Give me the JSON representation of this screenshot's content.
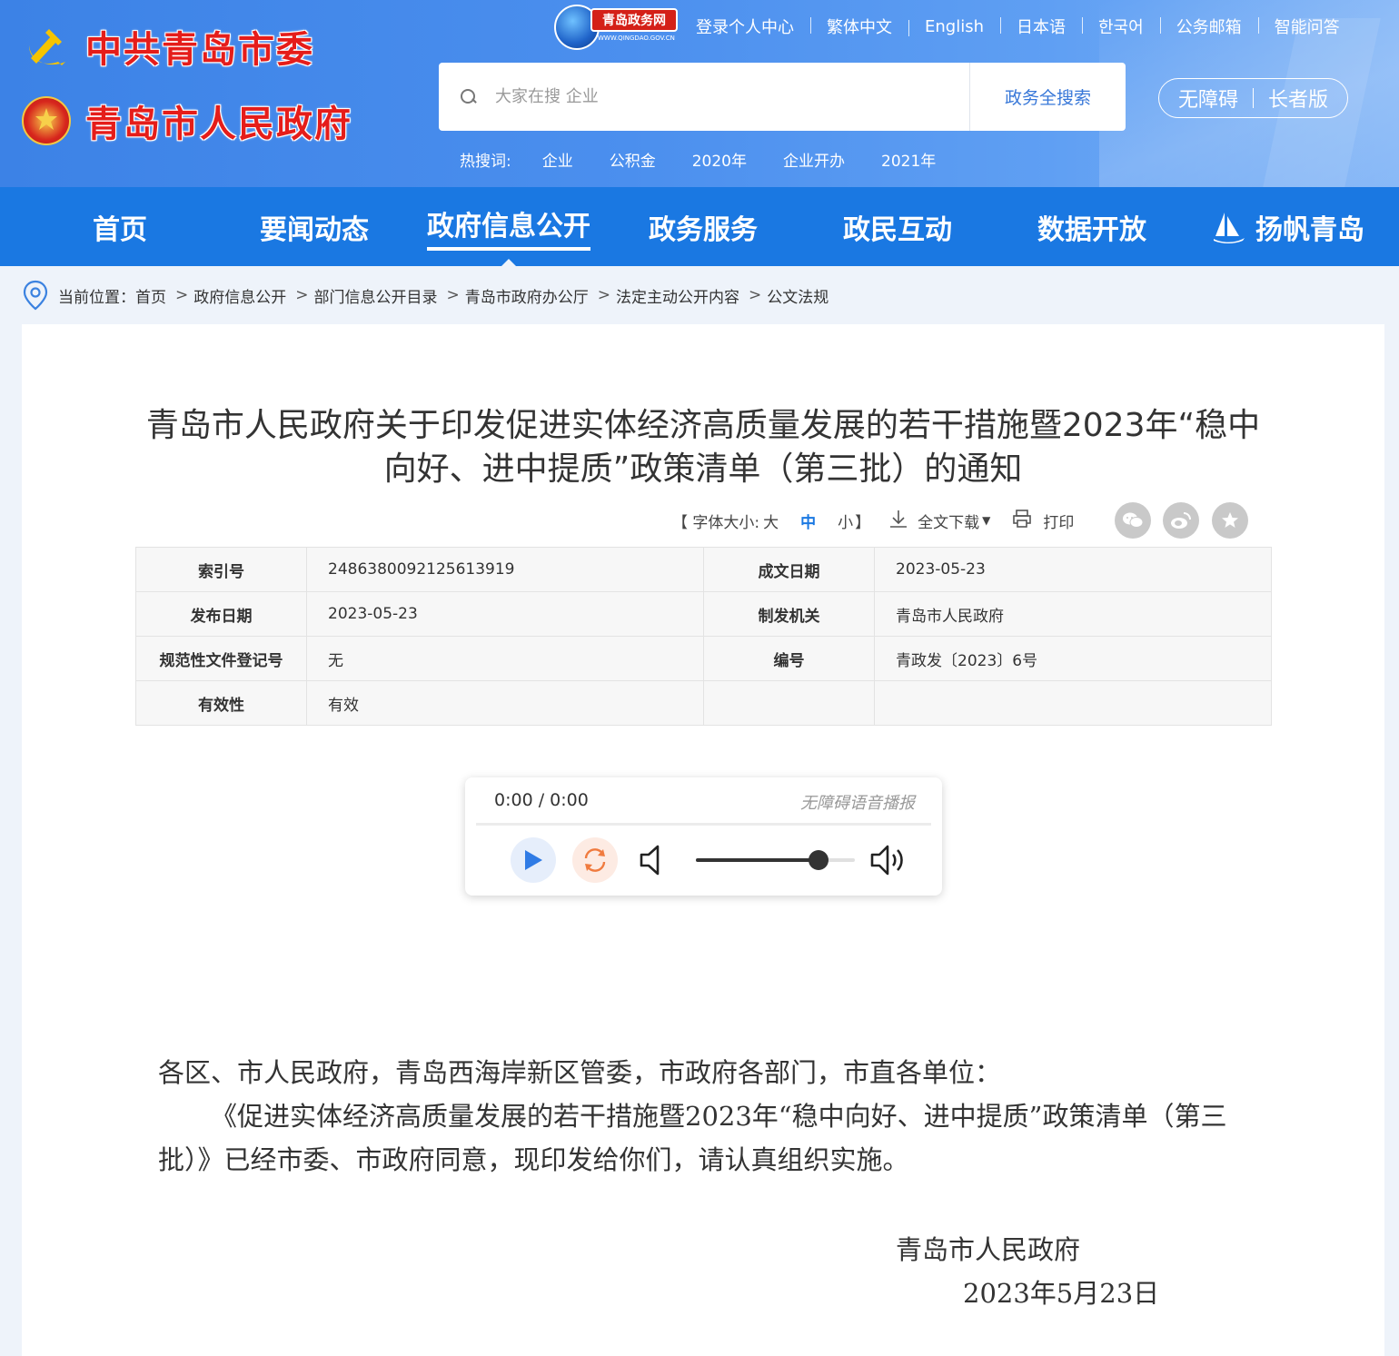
{
  "header": {
    "party_name": "中共青岛市委",
    "gov_name": "青岛市人民政府",
    "portal_badge": {
      "name": "青岛政务网",
      "url": "WWW.QINGDAO.GOV.CN"
    },
    "top_links": [
      "登录个人中心",
      "繁体中文",
      "English",
      "日本语",
      "한국어",
      "公务邮箱",
      "智能问答"
    ],
    "search": {
      "placeholder": "大家在搜 企业",
      "button": "政务全搜索"
    },
    "hot_words": {
      "label": "热搜词:",
      "items": [
        "企业",
        "公积金",
        "2020年",
        "企业开办",
        "2021年"
      ]
    },
    "accessibility": {
      "barrier_free": "无障碍",
      "elder_mode": "长者版"
    }
  },
  "nav": {
    "items": [
      "首页",
      "要闻动态",
      "政府信息公开",
      "政务服务",
      "政民互动",
      "数据开放",
      "扬帆青岛"
    ],
    "active": "政府信息公开"
  },
  "breadcrumb": {
    "label": "当前位置：",
    "items": [
      "首页",
      "政府信息公开",
      "部门信息公开目录",
      "青岛市政府办公厅",
      "法定主动公开内容",
      "公文法规"
    ]
  },
  "document": {
    "title": "青岛市人民政府关于印发促进实体经济高质量发展的若干措施暨2023年“稳中向好、进中提质”政策清单（第三批）的通知",
    "tools": {
      "font_size_label": "【 字体大小:",
      "font_sizes": [
        "大",
        "中",
        "小"
      ],
      "font_size_close": "】",
      "download": "全文下载",
      "print": "打印"
    },
    "meta": {
      "index_no_label": "索引号",
      "index_no": "2486380092125613919",
      "written_date_label": "成文日期",
      "written_date": "2023-05-23",
      "publish_date_label": "发布日期",
      "publish_date": "2023-05-23",
      "issuer_label": "制发机关",
      "issuer": "青岛市人民政府",
      "reg_no_label": "规范性文件登记号",
      "reg_no": "无",
      "doc_no_label": "编号",
      "doc_no": "青政发〔2023〕6号",
      "validity_label": "有效性",
      "validity": "有效"
    },
    "player": {
      "time": "0:00 / 0:00",
      "title": "无障碍语音播报",
      "volume": 0.77
    },
    "body": {
      "salutation": "各区、市人民政府，青岛西海岸新区管委，市政府各部门，市直各单位：",
      "paragraph": "《促进实体经济高质量发展的若干措施暨2023年“稳中向好、进中提质”政策清单（第三批）》已经市委、市政府同意，现印发给你们，请认真组织实施。",
      "signature": "青岛市人民政府",
      "date": "2023年5月23日"
    }
  },
  "colors": {
    "header_blue": "#4b8fee",
    "nav_blue": "#1a78e2",
    "logo_red": "#e51d1a",
    "loop_orange": "#f07b3f"
  }
}
